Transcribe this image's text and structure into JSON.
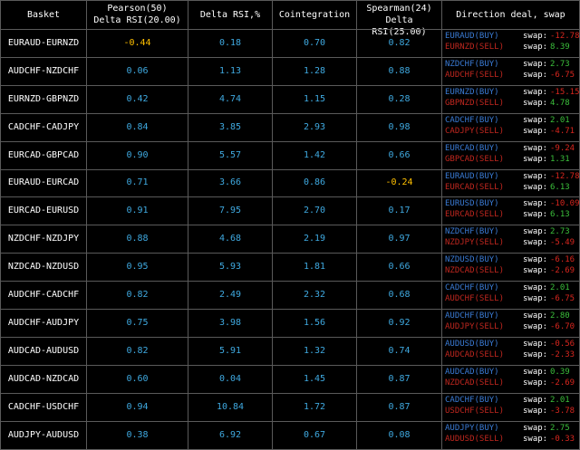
{
  "headers": {
    "basket": "Basket",
    "pearson_line1": "Pearson(50)",
    "pearson_line2": "Delta RSI(20.00)",
    "delta_rsi": "Delta RSI,%",
    "cointegration": "Cointegration",
    "spearman_line1": "Spearman(24)",
    "spearman_line2": "Delta RSI(25.00)",
    "direction": "Direction deal, swap"
  },
  "swap_label": "swap:",
  "colors": {
    "background": "#000000",
    "grid": "#5a5a5a",
    "value": "#3fa9e0",
    "highlight": "#ffc000",
    "buy": "#3a7bd5",
    "sell": "#c0271f",
    "swap_positive": "#3bbf3b",
    "swap_negative": "#d7261e",
    "text": "#ffffff"
  },
  "rows": [
    {
      "basket": "EURAUD-EURNZD",
      "pearson": "-0.44",
      "pearson_hl": true,
      "delta_rsi": "0.18",
      "coint": "0.70",
      "spearman": "0.82",
      "spearman_hl": false,
      "buy_pair": "EURAUD(BUY)",
      "buy_swap": "-12.78",
      "sell_pair": "EURNZD(SELL)",
      "sell_swap": "8.39"
    },
    {
      "basket": "AUDCHF-NZDCHF",
      "pearson": "0.06",
      "pearson_hl": false,
      "delta_rsi": "1.13",
      "coint": "1.28",
      "spearman": "0.88",
      "spearman_hl": false,
      "buy_pair": "NZDCHF(BUY)",
      "buy_swap": "2.73",
      "sell_pair": "AUDCHF(SELL)",
      "sell_swap": "-6.75"
    },
    {
      "basket": "EURNZD-GBPNZD",
      "pearson": "0.42",
      "pearson_hl": false,
      "delta_rsi": "4.74",
      "coint": "1.15",
      "spearman": "0.28",
      "spearman_hl": false,
      "buy_pair": "EURNZD(BUY)",
      "buy_swap": "-15.15",
      "sell_pair": "GBPNZD(SELL)",
      "sell_swap": "4.78"
    },
    {
      "basket": "CADCHF-CADJPY",
      "pearson": "0.84",
      "pearson_hl": false,
      "delta_rsi": "3.85",
      "coint": "2.93",
      "spearman": "0.98",
      "spearman_hl": false,
      "buy_pair": "CADCHF(BUY)",
      "buy_swap": "2.01",
      "sell_pair": "CADJPY(SELL)",
      "sell_swap": "-4.71"
    },
    {
      "basket": "EURCAD-GBPCAD",
      "pearson": "0.90",
      "pearson_hl": false,
      "delta_rsi": "5.57",
      "coint": "1.42",
      "spearman": "0.66",
      "spearman_hl": false,
      "buy_pair": "EURCAD(BUY)",
      "buy_swap": "-9.24",
      "sell_pair": "GBPCAD(SELL)",
      "sell_swap": "1.31"
    },
    {
      "basket": "EURAUD-EURCAD",
      "pearson": "0.71",
      "pearson_hl": false,
      "delta_rsi": "3.66",
      "coint": "0.86",
      "spearman": "-0.24",
      "spearman_hl": true,
      "buy_pair": "EURAUD(BUY)",
      "buy_swap": "-12.78",
      "sell_pair": "EURCAD(SELL)",
      "sell_swap": "6.13"
    },
    {
      "basket": "EURCAD-EURUSD",
      "pearson": "0.91",
      "pearson_hl": false,
      "delta_rsi": "7.95",
      "coint": "2.70",
      "spearman": "0.17",
      "spearman_hl": false,
      "buy_pair": "EURUSD(BUY)",
      "buy_swap": "-10.09",
      "sell_pair": "EURCAD(SELL)",
      "sell_swap": "6.13"
    },
    {
      "basket": "NZDCHF-NZDJPY",
      "pearson": "0.88",
      "pearson_hl": false,
      "delta_rsi": "4.68",
      "coint": "2.19",
      "spearman": "0.97",
      "spearman_hl": false,
      "buy_pair": "NZDCHF(BUY)",
      "buy_swap": "2.73",
      "sell_pair": "NZDJPY(SELL)",
      "sell_swap": "-5.49"
    },
    {
      "basket": "NZDCAD-NZDUSD",
      "pearson": "0.95",
      "pearson_hl": false,
      "delta_rsi": "5.93",
      "coint": "1.81",
      "spearman": "0.66",
      "spearman_hl": false,
      "buy_pair": "NZDUSD(BUY)",
      "buy_swap": "-6.16",
      "sell_pair": "NZDCAD(SELL)",
      "sell_swap": "-2.69"
    },
    {
      "basket": "AUDCHF-CADCHF",
      "pearson": "0.82",
      "pearson_hl": false,
      "delta_rsi": "2.49",
      "coint": "2.32",
      "spearman": "0.68",
      "spearman_hl": false,
      "buy_pair": "CADCHF(BUY)",
      "buy_swap": "2.01",
      "sell_pair": "AUDCHF(SELL)",
      "sell_swap": "-6.75"
    },
    {
      "basket": "AUDCHF-AUDJPY",
      "pearson": "0.75",
      "pearson_hl": false,
      "delta_rsi": "3.98",
      "coint": "1.56",
      "spearman": "0.92",
      "spearman_hl": false,
      "buy_pair": "AUDCHF(BUY)",
      "buy_swap": "2.80",
      "sell_pair": "AUDJPY(SELL)",
      "sell_swap": "-6.70"
    },
    {
      "basket": "AUDCAD-AUDUSD",
      "pearson": "0.82",
      "pearson_hl": false,
      "delta_rsi": "5.91",
      "coint": "1.32",
      "spearman": "0.74",
      "spearman_hl": false,
      "buy_pair": "AUDUSD(BUY)",
      "buy_swap": "-0.56",
      "sell_pair": "AUDCAD(SELL)",
      "sell_swap": "-2.33"
    },
    {
      "basket": "AUDCAD-NZDCAD",
      "pearson": "0.60",
      "pearson_hl": false,
      "delta_rsi": "0.04",
      "coint": "1.45",
      "spearman": "0.87",
      "spearman_hl": false,
      "buy_pair": "AUDCAD(BUY)",
      "buy_swap": "0.39",
      "sell_pair": "NZDCAD(SELL)",
      "sell_swap": "-2.69"
    },
    {
      "basket": "CADCHF-USDCHF",
      "pearson": "0.94",
      "pearson_hl": false,
      "delta_rsi": "10.84",
      "coint": "1.72",
      "spearman": "0.87",
      "spearman_hl": false,
      "buy_pair": "CADCHF(BUY)",
      "buy_swap": "2.01",
      "sell_pair": "USDCHF(SELL)",
      "sell_swap": "-3.78"
    },
    {
      "basket": "AUDJPY-AUDUSD",
      "pearson": "0.38",
      "pearson_hl": false,
      "delta_rsi": "6.92",
      "coint": "0.67",
      "spearman": "0.08",
      "spearman_hl": false,
      "buy_pair": "AUDJPY(BUY)",
      "buy_swap": "2.75",
      "sell_pair": "AUDUSD(SELL)",
      "sell_swap": "-0.33"
    }
  ]
}
